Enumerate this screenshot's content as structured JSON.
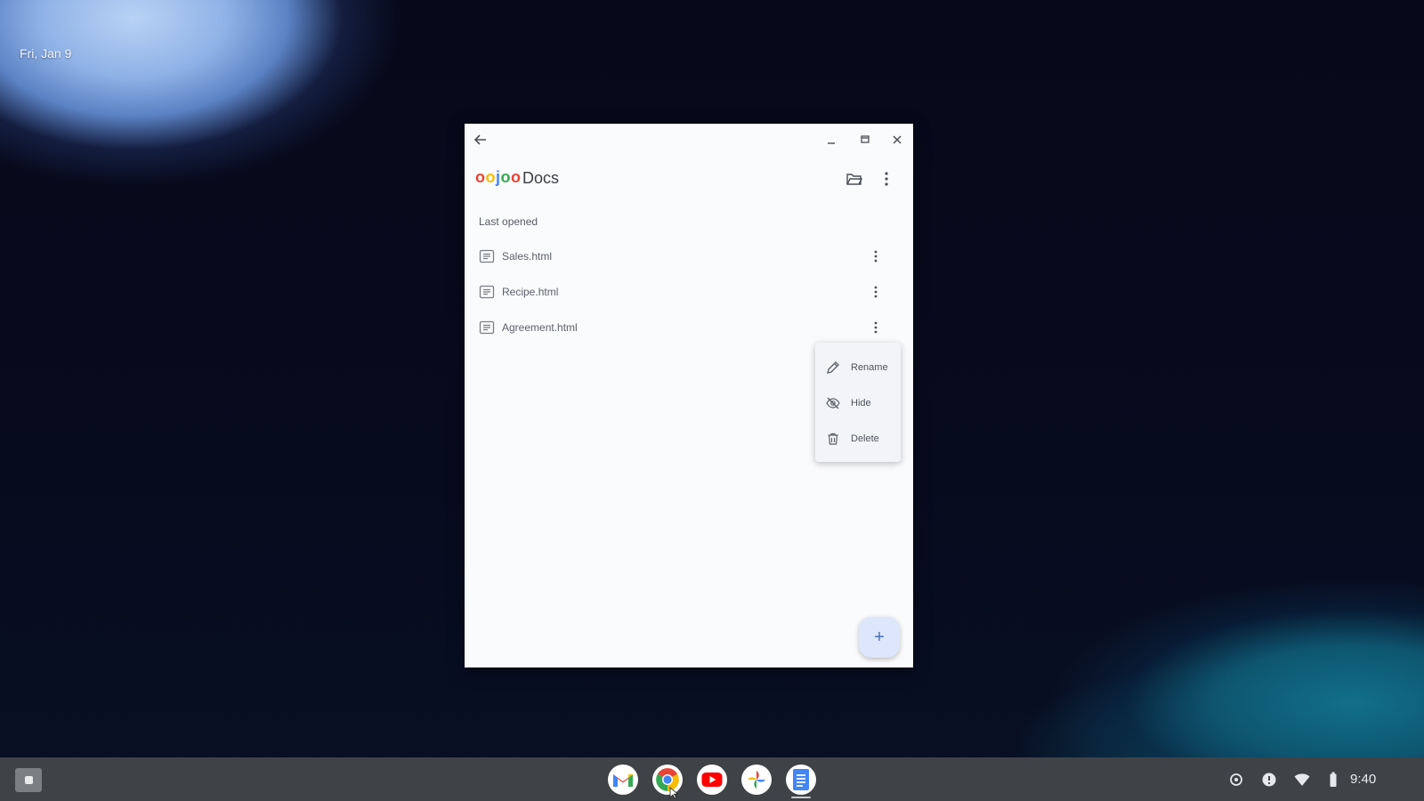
{
  "desktop": {
    "date": "Fri, Jan 9"
  },
  "window": {
    "controls": {
      "back": "back-arrow-icon",
      "minimize": "minimize-icon",
      "maximize": "maximize-icon",
      "close": "close-icon"
    },
    "header": {
      "logo_letters": [
        "o",
        "o",
        "j",
        "o",
        "o"
      ],
      "logo_colors": [
        "#ea4335",
        "#fbbc04",
        "#4285f4",
        "#34a853",
        "#ea4335"
      ],
      "title": "Docs",
      "folder_icon": "folder-open-icon",
      "more_icon": "more-vert-icon"
    },
    "section_title": "Last opened",
    "files": [
      {
        "name": "Sales.html",
        "icon": "document-icon"
      },
      {
        "name": "Recipe.html",
        "icon": "document-icon"
      },
      {
        "name": "Agreement.html",
        "icon": "document-icon"
      }
    ],
    "context_menu": {
      "items": [
        {
          "label": "Rename",
          "icon": "pencil-icon"
        },
        {
          "label": "Hide",
          "icon": "eye-off-icon"
        },
        {
          "label": "Delete",
          "icon": "trash-icon"
        }
      ]
    },
    "fab": {
      "label": "+"
    }
  },
  "shelf": {
    "apps": [
      "Gmail",
      "Chrome",
      "YouTube",
      "Photos",
      "Docs"
    ],
    "clock": "9:40",
    "tray_icons": [
      "settings-icon",
      "info-icon",
      "wifi-icon",
      "battery-icon"
    ]
  },
  "colors": {
    "window_bg": "#fafbfd",
    "shelf_bg": "#3f4247",
    "fab_bg": "#dde6fb",
    "menu_bg": "#f2f4f7"
  }
}
